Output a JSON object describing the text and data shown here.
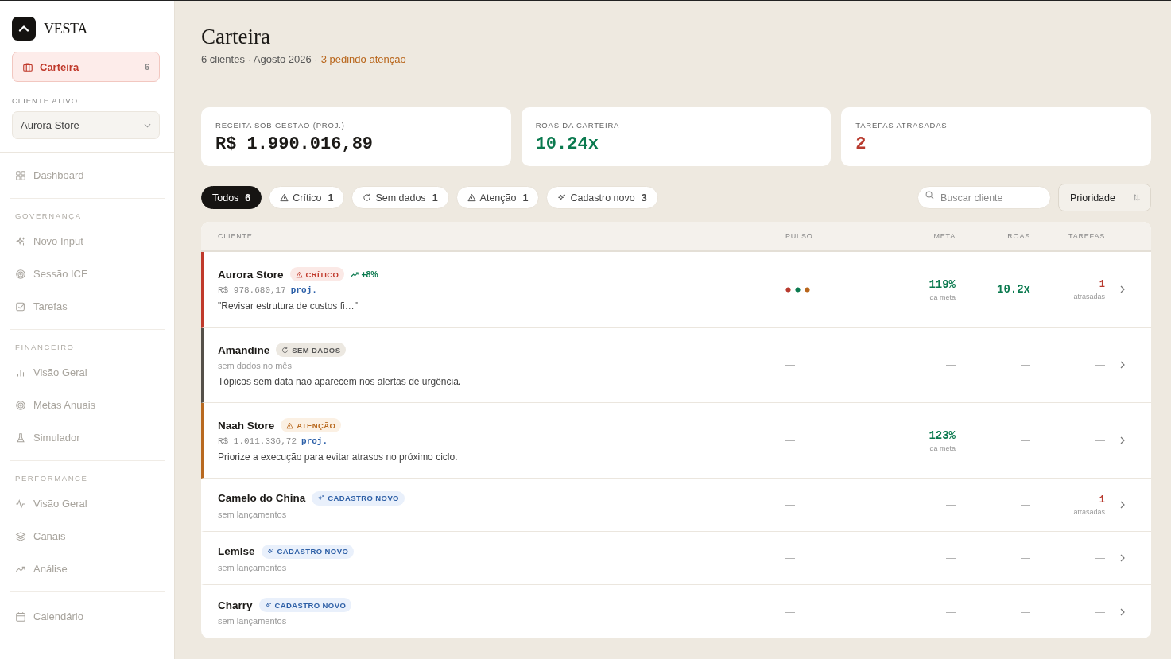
{
  "brand": {
    "name": "VESTA"
  },
  "sidebar": {
    "primary": {
      "label": "Carteira",
      "count": "6",
      "selected": true
    },
    "active_client": {
      "label": "CLIENTE ATIVO",
      "value": "Aurora Store"
    },
    "sections": [
      {
        "items": [
          {
            "label": "Dashboard",
            "selected": false
          }
        ]
      },
      {
        "title": "GOVERNANÇA",
        "items": [
          {
            "label": "Novo Input",
            "selected": false
          },
          {
            "label": "Sessão ICE",
            "selected": false
          },
          {
            "label": "Tarefas",
            "selected": false
          }
        ]
      },
      {
        "title": "FINANCEIRO",
        "items": [
          {
            "label": "Visão Geral",
            "selected": false
          },
          {
            "label": "Metas Anuais",
            "selected": false
          },
          {
            "label": "Simulador",
            "selected": false
          }
        ]
      },
      {
        "title": "PERFORMANCE",
        "items": [
          {
            "label": "Visão Geral",
            "selected": false
          },
          {
            "label": "Canais",
            "selected": false
          },
          {
            "label": "Análise",
            "selected": false
          }
        ]
      },
      {
        "items": [
          {
            "label": "Calendário",
            "selected": false
          }
        ]
      }
    ]
  },
  "header": {
    "title": "Carteira",
    "subtitle": "6 clientes · Agosto 2026 ·",
    "alert": "3 pedindo atenção"
  },
  "stats": [
    {
      "label": "RECEITA SOB GESTÃO (PROJ.)",
      "value": "R$ 1.990.016,89",
      "kind": "neutral"
    },
    {
      "label": "ROAS DA CARTEIRA",
      "value": "10.24x",
      "kind": "positive"
    },
    {
      "label": "TAREFAS ATRASADAS",
      "value": "2",
      "kind": "negative"
    }
  ],
  "filters": [
    {
      "label": "Todos",
      "count": "6",
      "kind": "all",
      "selected": true
    },
    {
      "label": "Crítico",
      "count": "1",
      "kind": "critical",
      "selected": false
    },
    {
      "label": "Sem dados",
      "count": "1",
      "kind": "nodata",
      "selected": false
    },
    {
      "label": "Atenção",
      "count": "1",
      "kind": "attention",
      "selected": false
    },
    {
      "label": "Cadastro novo",
      "count": "3",
      "kind": "new",
      "selected": false
    }
  ],
  "search": {
    "placeholder": "Buscar cliente"
  },
  "sort": {
    "value": "Prioridade"
  },
  "table": {
    "columns": [
      "CLIENTE",
      "PULSO",
      "META",
      "ROAS",
      "TAREFAS"
    ],
    "rows": [
      {
        "name": "Aurora Store",
        "status": {
          "kind": "critical",
          "label": "CRÍTICO"
        },
        "trend": "+8%",
        "revenue": "R$ 978.680,17",
        "proj": "proj.",
        "note": "\"Revisar estrutura de custos fi…\"",
        "pulse": [
          {
            "color": "#b83a2e"
          },
          {
            "color": "#0b7a4f"
          },
          {
            "color": "#b8651a"
          }
        ],
        "meta": {
          "kind": "value",
          "value": "119%",
          "caption": "da meta"
        },
        "roas": {
          "kind": "value",
          "value": "10.2x"
        },
        "tasks": {
          "kind": "value",
          "value": "1",
          "caption": "atrasadas"
        }
      },
      {
        "name": "Amandine",
        "status": {
          "kind": "nodata",
          "label": "SEM DADOS"
        },
        "info": "sem dados no mês",
        "note": "Tópicos sem data não aparecem nos alertas de urgência.",
        "pulse_empty": "—",
        "meta": {
          "kind": "empty",
          "value": "—"
        },
        "roas": {
          "kind": "empty",
          "value": "—"
        },
        "tasks": {
          "kind": "empty",
          "value": "—"
        }
      },
      {
        "name": "Naah Store",
        "status": {
          "kind": "attention",
          "label": "ATENÇÃO"
        },
        "revenue": "R$ 1.011.336,72",
        "proj": "proj.",
        "note": "Priorize a execução para evitar atrasos no próximo ciclo.",
        "pulse_empty": "—",
        "meta": {
          "kind": "value",
          "value": "123%",
          "caption": "da meta"
        },
        "roas": {
          "kind": "empty",
          "value": "—"
        },
        "tasks": {
          "kind": "empty",
          "value": "—"
        }
      },
      {
        "name": "Camelo do China",
        "status": {
          "kind": "new",
          "label": "CADASTRO NOVO"
        },
        "info": "sem lançamentos",
        "pulse_empty": "—",
        "meta": {
          "kind": "empty",
          "value": "—"
        },
        "roas": {
          "kind": "empty",
          "value": "—"
        },
        "tasks": {
          "kind": "value",
          "value": "1",
          "caption": "atrasadas"
        }
      },
      {
        "name": "Lemise",
        "status": {
          "kind": "new",
          "label": "CADASTRO NOVO"
        },
        "info": "sem lançamentos",
        "pulse_empty": "—",
        "meta": {
          "kind": "empty",
          "value": "—"
        },
        "roas": {
          "kind": "empty",
          "value": "—"
        },
        "tasks": {
          "kind": "empty",
          "value": "—"
        }
      },
      {
        "name": "Charry",
        "status": {
          "kind": "new",
          "label": "CADASTRO NOVO"
        },
        "info": "sem lançamentos",
        "pulse_empty": "—",
        "meta": {
          "kind": "empty",
          "value": "—"
        },
        "roas": {
          "kind": "empty",
          "value": "—"
        },
        "tasks": {
          "kind": "empty",
          "value": "—"
        }
      }
    ]
  }
}
